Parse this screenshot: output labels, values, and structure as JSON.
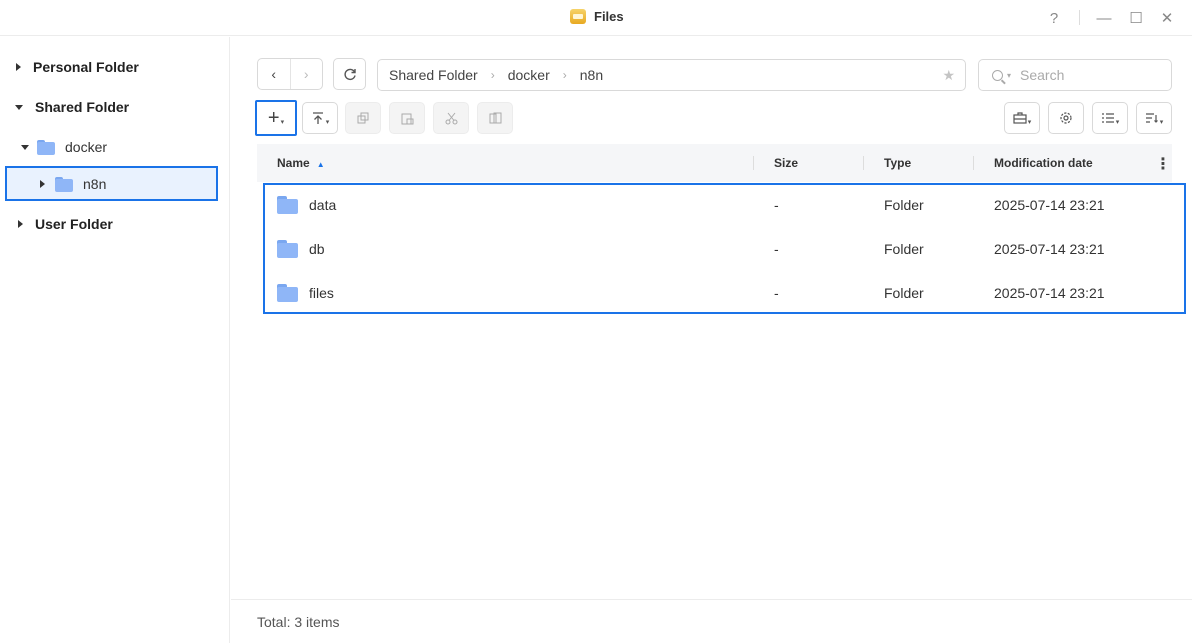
{
  "window": {
    "title": "Files",
    "help": "?",
    "minimize": "—",
    "maximize": "☐",
    "close": "✕"
  },
  "sidebar": {
    "personal_folder": "Personal Folder",
    "shared_folder": "Shared Folder",
    "docker": "docker",
    "n8n": "n8n",
    "user_folder": "User Folder"
  },
  "toolbar": {
    "back": "‹",
    "forward": "›",
    "refresh_icon": "refresh-icon",
    "breadcrumb": [
      "Shared Folder",
      "docker",
      "n8n"
    ],
    "search_placeholder": "Search",
    "create": "+",
    "upload_icon": "upload-icon",
    "copy_icon": "copy-icon",
    "paste_icon": "paste-icon",
    "cut_icon": "cut-icon",
    "move_icon": "move-icon",
    "tools_icon": "toolbox-icon",
    "settings_icon": "gear-icon",
    "view_icon": "list-view-icon",
    "sort_icon": "sort-icon"
  },
  "table": {
    "headers": {
      "name": "Name",
      "size": "Size",
      "type": "Type",
      "date": "Modification date"
    },
    "rows": [
      {
        "name": "data",
        "size": "-",
        "type": "Folder",
        "date": "2025-07-14 23:21"
      },
      {
        "name": "db",
        "size": "-",
        "type": "Folder",
        "date": "2025-07-14 23:21"
      },
      {
        "name": "files",
        "size": "-",
        "type": "Folder",
        "date": "2025-07-14 23:21"
      }
    ]
  },
  "footer": {
    "total": "Total: 3 items"
  },
  "colors": {
    "accent": "#1a73e8",
    "folder": "#8fb6f7"
  }
}
